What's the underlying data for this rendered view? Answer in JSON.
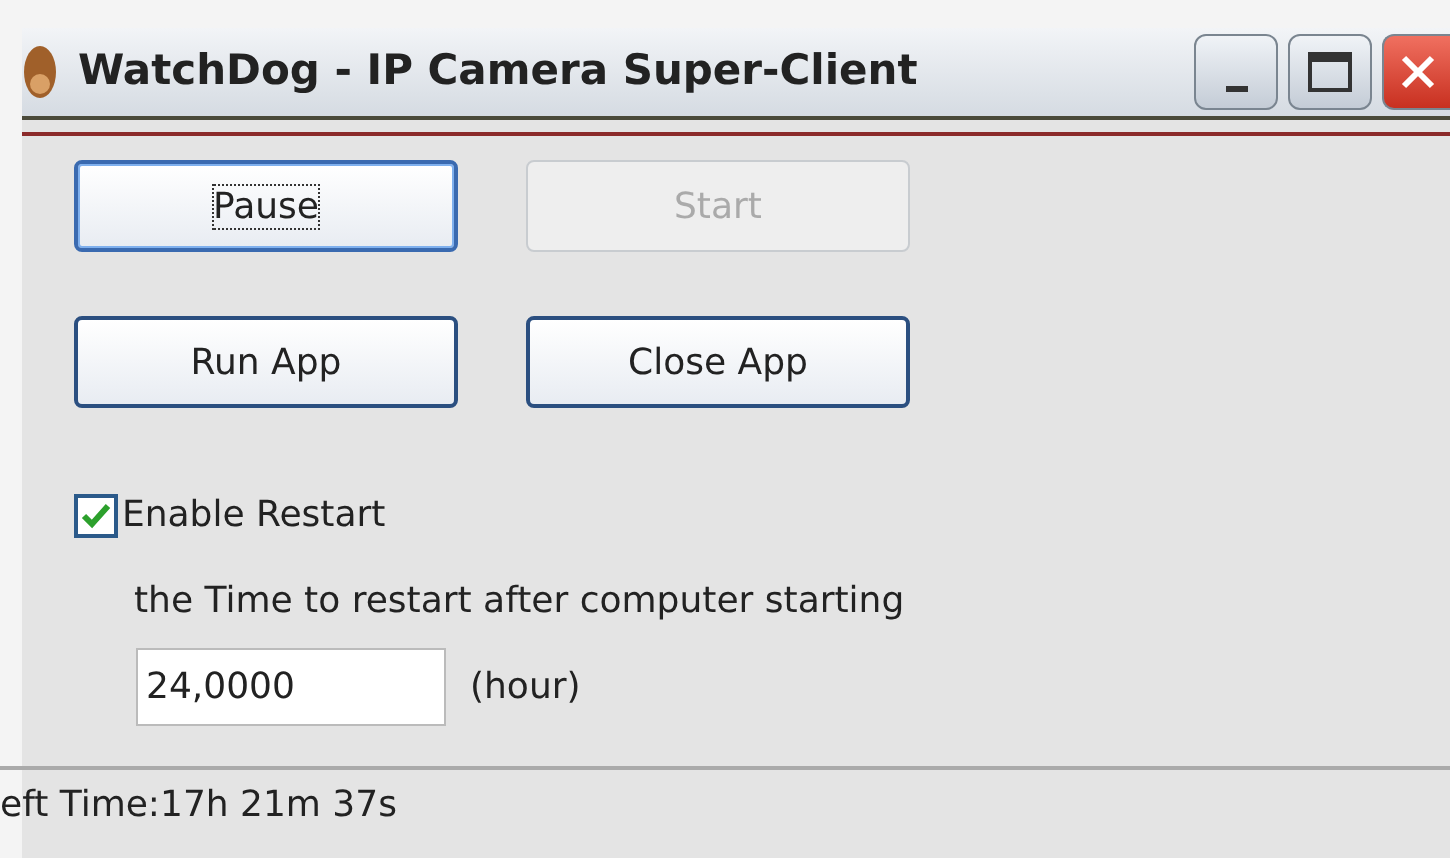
{
  "window": {
    "title": "WatchDog - IP Camera Super-Client"
  },
  "buttons": [
    {
      "label": "Pause",
      "disabled": false,
      "focused": true
    },
    {
      "label": "Start",
      "disabled": true,
      "focused": false
    },
    {
      "label": "Run App",
      "disabled": false,
      "focused": false
    },
    {
      "label": "Close App",
      "disabled": false,
      "focused": false
    }
  ],
  "restart": {
    "label": "Enable Restart",
    "checked": true
  },
  "prompt": "the Time to restart after computer starting",
  "hours": {
    "value": "24,0000",
    "unit": "(hour)"
  },
  "status_bar": "eft Time:17h 21m 37s"
}
